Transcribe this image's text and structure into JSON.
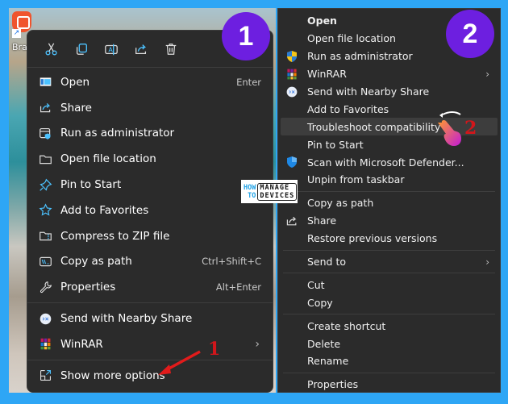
{
  "desktop": {
    "icon_label": "Bra",
    "icon_name": "brave-browser-shortcut"
  },
  "menu1": {
    "toolbar": [
      {
        "name": "cut",
        "icon": "scissors-icon"
      },
      {
        "name": "copy",
        "icon": "copy-icon"
      },
      {
        "name": "rename",
        "icon": "rename-icon"
      },
      {
        "name": "share",
        "icon": "share-icon"
      },
      {
        "name": "delete",
        "icon": "trash-icon"
      }
    ],
    "items": [
      {
        "label": "Open",
        "shortcut": "Enter",
        "icon": "open-app-icon"
      },
      {
        "label": "Share",
        "shortcut": "",
        "icon": "share-icon"
      },
      {
        "label": "Run as administrator",
        "shortcut": "",
        "icon": "admin-shield-icon"
      },
      {
        "label": "Open file location",
        "shortcut": "",
        "icon": "folder-icon"
      },
      {
        "label": "Pin to Start",
        "shortcut": "",
        "icon": "pin-icon"
      },
      {
        "label": "Add to Favorites",
        "shortcut": "",
        "icon": "star-icon"
      },
      {
        "label": "Compress to ZIP file",
        "shortcut": "",
        "icon": "zip-folder-icon"
      },
      {
        "label": "Copy as path",
        "shortcut": "Ctrl+Shift+C",
        "icon": "copy-path-icon"
      },
      {
        "label": "Properties",
        "shortcut": "Alt+Enter",
        "icon": "wrench-icon"
      }
    ],
    "extra_items": [
      {
        "label": "Send with Nearby Share",
        "icon": "nearby-share-icon",
        "submenu": false
      },
      {
        "label": "WinRAR",
        "icon": "winrar-icon",
        "submenu": true
      }
    ],
    "more_options": {
      "label": "Show more options",
      "icon": "show-more-icon"
    },
    "badge": "1"
  },
  "menu2": {
    "badge": "2",
    "groups": [
      [
        {
          "label": "Open",
          "bold": true,
          "icon": ""
        },
        {
          "label": "Open file location",
          "icon": ""
        },
        {
          "label": "Run as administrator",
          "icon": "uac-shield-icon"
        },
        {
          "label": "WinRAR",
          "icon": "winrar-icon",
          "submenu": true
        },
        {
          "label": "Send with Nearby Share",
          "icon": "nearby-share-icon"
        },
        {
          "label": "Add to Favorites",
          "icon": ""
        },
        {
          "label": "Troubleshoot compatibility",
          "icon": "",
          "highlighted": true
        },
        {
          "label": "Pin to Start",
          "icon": ""
        },
        {
          "label": "Scan with Microsoft Defender...",
          "icon": "defender-shield-icon"
        },
        {
          "label": "Unpin from taskbar",
          "icon": ""
        }
      ],
      [
        {
          "label": "Copy as path",
          "icon": ""
        },
        {
          "label": "Share",
          "icon": "share-icon"
        },
        {
          "label": "Restore previous versions",
          "icon": ""
        }
      ],
      [
        {
          "label": "Send to",
          "icon": "",
          "submenu": true
        }
      ],
      [
        {
          "label": "Cut",
          "icon": ""
        },
        {
          "label": "Copy",
          "icon": ""
        }
      ],
      [
        {
          "label": "Create shortcut",
          "icon": ""
        },
        {
          "label": "Delete",
          "icon": ""
        },
        {
          "label": "Rename",
          "icon": ""
        }
      ],
      [
        {
          "label": "Properties",
          "icon": ""
        }
      ]
    ]
  },
  "watermark": {
    "line1a": "HOW",
    "line1b": "MANAGE",
    "line2a": "TO",
    "line2b": "DEVICES"
  },
  "annotations": {
    "step1": "1",
    "step2": "2"
  },
  "colors": {
    "background": "#2ea6f5",
    "menu_bg": "#2b2b2b",
    "badge": "#6d1fe0",
    "annotation_red": "#d2161b",
    "accent_blue": "#4cc2ff"
  }
}
